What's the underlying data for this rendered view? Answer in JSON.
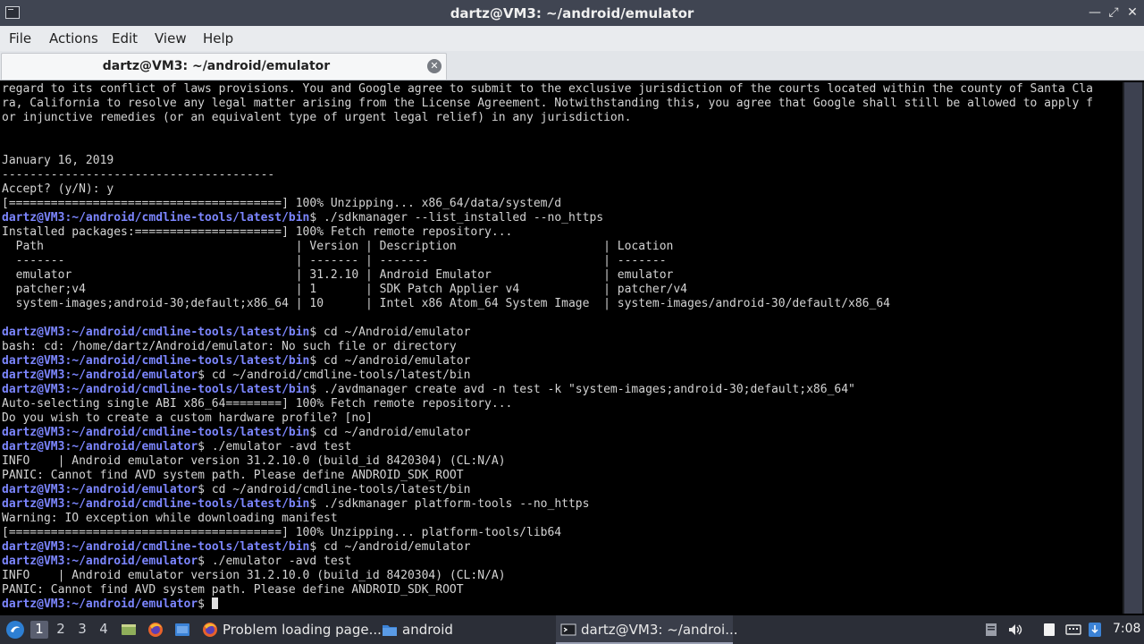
{
  "window": {
    "title": "dartz@VM3: ~/android/emulator"
  },
  "menu": [
    "File",
    "Actions",
    "Edit",
    "View",
    "Help"
  ],
  "tab": {
    "label": "dartz@VM3: ~/android/emulator",
    "close_glyph": "✕"
  },
  "terminal": {
    "prompt_user": "dartz@VM3",
    "lines": [
      {
        "t": "regard to its conflict of laws provisions. You and Google agree to submit to the exclusive jurisdiction of the courts located within the county of Santa Cla"
      },
      {
        "t": "ra, California to resolve any legal matter arising from the License Agreement. Notwithstanding this, you agree that Google shall still be allowed to apply f"
      },
      {
        "t": "or injunctive remedies (or an equivalent type of urgent legal relief) in any jurisdiction."
      },
      {
        "t": ""
      },
      {
        "t": ""
      },
      {
        "t": "January 16, 2019"
      },
      {
        "t": "---------------------------------------"
      },
      {
        "t": "Accept? (y/N): y"
      },
      {
        "t": "[=======================================] 100% Unzipping... x86_64/data/system/d"
      },
      {
        "p": "~/android/cmdline-tools/latest/bin",
        "t": "$ ./sdkmanager --list_installed --no_https"
      },
      {
        "t": "Installed packages:=====================] 100% Fetch remote repository..."
      },
      {
        "t": "  Path                                    | Version | Description                     | Location"
      },
      {
        "t": "  -------                                 | ------- | -------                         | -------"
      },
      {
        "t": "  emulator                                | 31.2.10 | Android Emulator                | emulator"
      },
      {
        "t": "  patcher;v4                              | 1       | SDK Patch Applier v4            | patcher/v4"
      },
      {
        "t": "  system-images;android-30;default;x86_64 | 10      | Intel x86 Atom_64 System Image  | system-images/android-30/default/x86_64"
      },
      {
        "t": ""
      },
      {
        "p": "~/android/cmdline-tools/latest/bin",
        "t": "$ cd ~/Android/emulator"
      },
      {
        "t": "bash: cd: /home/dartz/Android/emulator: No such file or directory"
      },
      {
        "p": "~/android/cmdline-tools/latest/bin",
        "t": "$ cd ~/android/emulator"
      },
      {
        "p": "~/android/emulator",
        "t": "$ cd ~/android/cmdline-tools/latest/bin"
      },
      {
        "p": "~/android/cmdline-tools/latest/bin",
        "t": "$ ./avdmanager create avd -n test -k \"system-images;android-30;default;x86_64\""
      },
      {
        "t": "Auto-selecting single ABI x86_64========] 100% Fetch remote repository..."
      },
      {
        "t": "Do you wish to create a custom hardware profile? [no]"
      },
      {
        "p": "~/android/cmdline-tools/latest/bin",
        "t": "$ cd ~/android/emulator"
      },
      {
        "p": "~/android/emulator",
        "t": "$ ./emulator -avd test"
      },
      {
        "t": "INFO    | Android emulator version 31.2.10.0 (build_id 8420304) (CL:N/A)"
      },
      {
        "t": "PANIC: Cannot find AVD system path. Please define ANDROID_SDK_ROOT"
      },
      {
        "p": "~/android/emulator",
        "t": "$ cd ~/android/cmdline-tools/latest/bin"
      },
      {
        "p": "~/android/cmdline-tools/latest/bin",
        "t": "$ ./sdkmanager platform-tools --no_https"
      },
      {
        "t": "Warning: IO exception while downloading manifest"
      },
      {
        "t": "[=======================================] 100% Unzipping... platform-tools/lib64"
      },
      {
        "p": "~/android/cmdline-tools/latest/bin",
        "t": "$ cd ~/android/emulator"
      },
      {
        "p": "~/android/emulator",
        "t": "$ ./emulator -avd test"
      },
      {
        "t": "INFO    | Android emulator version 31.2.10.0 (build_id 8420304) (CL:N/A)"
      },
      {
        "t": "PANIC: Cannot find AVD system path. Please define ANDROID_SDK_ROOT"
      },
      {
        "p": "~/android/emulator",
        "t": "$ ",
        "cursor": true
      }
    ]
  },
  "taskbar": {
    "workspaces": [
      "1",
      "2",
      "3",
      "4"
    ],
    "active_workspace": "1",
    "tasks": [
      {
        "icon": "firefox-icon",
        "label": "Problem loading page..."
      },
      {
        "icon": "folder-icon",
        "label": "android"
      },
      {
        "icon": "terminal-icon",
        "label": "dartz@VM3: ~/androi..."
      }
    ],
    "clock": "7:08"
  },
  "colors": {
    "prompt": "#7c86ff",
    "terminal_bg": "#000000",
    "terminal_fg": "#d3d3d3"
  }
}
